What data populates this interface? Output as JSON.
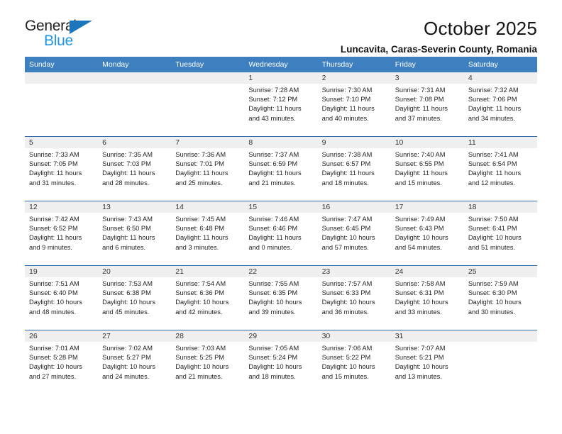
{
  "brand": {
    "name_part1": "General",
    "name_part2": "Blue",
    "accent_color": "#1b76bc",
    "logo_blue_text_color": "#2196e8"
  },
  "header": {
    "month_title": "October 2025",
    "location": "Luncavita, Caras-Severin County, Romania"
  },
  "calendar": {
    "header_background": "#3d7fbf",
    "row_rule_color": "#2e6da8",
    "daynum_band_color": "#efefef",
    "weekday_headers": [
      "Sunday",
      "Monday",
      "Tuesday",
      "Wednesday",
      "Thursday",
      "Friday",
      "Saturday"
    ],
    "weeks": [
      [
        {
          "day": "",
          "empty": true,
          "sunrise": "",
          "sunset": "",
          "daylight_line1": "",
          "daylight_line2": ""
        },
        {
          "day": "",
          "empty": true,
          "sunrise": "",
          "sunset": "",
          "daylight_line1": "",
          "daylight_line2": ""
        },
        {
          "day": "",
          "empty": true,
          "sunrise": "",
          "sunset": "",
          "daylight_line1": "",
          "daylight_line2": ""
        },
        {
          "day": "1",
          "empty": false,
          "sunrise": "Sunrise: 7:28 AM",
          "sunset": "Sunset: 7:12 PM",
          "daylight_line1": "Daylight: 11 hours",
          "daylight_line2": "and 43 minutes."
        },
        {
          "day": "2",
          "empty": false,
          "sunrise": "Sunrise: 7:30 AM",
          "sunset": "Sunset: 7:10 PM",
          "daylight_line1": "Daylight: 11 hours",
          "daylight_line2": "and 40 minutes."
        },
        {
          "day": "3",
          "empty": false,
          "sunrise": "Sunrise: 7:31 AM",
          "sunset": "Sunset: 7:08 PM",
          "daylight_line1": "Daylight: 11 hours",
          "daylight_line2": "and 37 minutes."
        },
        {
          "day": "4",
          "empty": false,
          "sunrise": "Sunrise: 7:32 AM",
          "sunset": "Sunset: 7:06 PM",
          "daylight_line1": "Daylight: 11 hours",
          "daylight_line2": "and 34 minutes."
        }
      ],
      [
        {
          "day": "5",
          "empty": false,
          "sunrise": "Sunrise: 7:33 AM",
          "sunset": "Sunset: 7:05 PM",
          "daylight_line1": "Daylight: 11 hours",
          "daylight_line2": "and 31 minutes."
        },
        {
          "day": "6",
          "empty": false,
          "sunrise": "Sunrise: 7:35 AM",
          "sunset": "Sunset: 7:03 PM",
          "daylight_line1": "Daylight: 11 hours",
          "daylight_line2": "and 28 minutes."
        },
        {
          "day": "7",
          "empty": false,
          "sunrise": "Sunrise: 7:36 AM",
          "sunset": "Sunset: 7:01 PM",
          "daylight_line1": "Daylight: 11 hours",
          "daylight_line2": "and 25 minutes."
        },
        {
          "day": "8",
          "empty": false,
          "sunrise": "Sunrise: 7:37 AM",
          "sunset": "Sunset: 6:59 PM",
          "daylight_line1": "Daylight: 11 hours",
          "daylight_line2": "and 21 minutes."
        },
        {
          "day": "9",
          "empty": false,
          "sunrise": "Sunrise: 7:38 AM",
          "sunset": "Sunset: 6:57 PM",
          "daylight_line1": "Daylight: 11 hours",
          "daylight_line2": "and 18 minutes."
        },
        {
          "day": "10",
          "empty": false,
          "sunrise": "Sunrise: 7:40 AM",
          "sunset": "Sunset: 6:55 PM",
          "daylight_line1": "Daylight: 11 hours",
          "daylight_line2": "and 15 minutes."
        },
        {
          "day": "11",
          "empty": false,
          "sunrise": "Sunrise: 7:41 AM",
          "sunset": "Sunset: 6:54 PM",
          "daylight_line1": "Daylight: 11 hours",
          "daylight_line2": "and 12 minutes."
        }
      ],
      [
        {
          "day": "12",
          "empty": false,
          "sunrise": "Sunrise: 7:42 AM",
          "sunset": "Sunset: 6:52 PM",
          "daylight_line1": "Daylight: 11 hours",
          "daylight_line2": "and 9 minutes."
        },
        {
          "day": "13",
          "empty": false,
          "sunrise": "Sunrise: 7:43 AM",
          "sunset": "Sunset: 6:50 PM",
          "daylight_line1": "Daylight: 11 hours",
          "daylight_line2": "and 6 minutes."
        },
        {
          "day": "14",
          "empty": false,
          "sunrise": "Sunrise: 7:45 AM",
          "sunset": "Sunset: 6:48 PM",
          "daylight_line1": "Daylight: 11 hours",
          "daylight_line2": "and 3 minutes."
        },
        {
          "day": "15",
          "empty": false,
          "sunrise": "Sunrise: 7:46 AM",
          "sunset": "Sunset: 6:46 PM",
          "daylight_line1": "Daylight: 11 hours",
          "daylight_line2": "and 0 minutes."
        },
        {
          "day": "16",
          "empty": false,
          "sunrise": "Sunrise: 7:47 AM",
          "sunset": "Sunset: 6:45 PM",
          "daylight_line1": "Daylight: 10 hours",
          "daylight_line2": "and 57 minutes."
        },
        {
          "day": "17",
          "empty": false,
          "sunrise": "Sunrise: 7:49 AM",
          "sunset": "Sunset: 6:43 PM",
          "daylight_line1": "Daylight: 10 hours",
          "daylight_line2": "and 54 minutes."
        },
        {
          "day": "18",
          "empty": false,
          "sunrise": "Sunrise: 7:50 AM",
          "sunset": "Sunset: 6:41 PM",
          "daylight_line1": "Daylight: 10 hours",
          "daylight_line2": "and 51 minutes."
        }
      ],
      [
        {
          "day": "19",
          "empty": false,
          "sunrise": "Sunrise: 7:51 AM",
          "sunset": "Sunset: 6:40 PM",
          "daylight_line1": "Daylight: 10 hours",
          "daylight_line2": "and 48 minutes."
        },
        {
          "day": "20",
          "empty": false,
          "sunrise": "Sunrise: 7:53 AM",
          "sunset": "Sunset: 6:38 PM",
          "daylight_line1": "Daylight: 10 hours",
          "daylight_line2": "and 45 minutes."
        },
        {
          "day": "21",
          "empty": false,
          "sunrise": "Sunrise: 7:54 AM",
          "sunset": "Sunset: 6:36 PM",
          "daylight_line1": "Daylight: 10 hours",
          "daylight_line2": "and 42 minutes."
        },
        {
          "day": "22",
          "empty": false,
          "sunrise": "Sunrise: 7:55 AM",
          "sunset": "Sunset: 6:35 PM",
          "daylight_line1": "Daylight: 10 hours",
          "daylight_line2": "and 39 minutes."
        },
        {
          "day": "23",
          "empty": false,
          "sunrise": "Sunrise: 7:57 AM",
          "sunset": "Sunset: 6:33 PM",
          "daylight_line1": "Daylight: 10 hours",
          "daylight_line2": "and 36 minutes."
        },
        {
          "day": "24",
          "empty": false,
          "sunrise": "Sunrise: 7:58 AM",
          "sunset": "Sunset: 6:31 PM",
          "daylight_line1": "Daylight: 10 hours",
          "daylight_line2": "and 33 minutes."
        },
        {
          "day": "25",
          "empty": false,
          "sunrise": "Sunrise: 7:59 AM",
          "sunset": "Sunset: 6:30 PM",
          "daylight_line1": "Daylight: 10 hours",
          "daylight_line2": "and 30 minutes."
        }
      ],
      [
        {
          "day": "26",
          "empty": false,
          "sunrise": "Sunrise: 7:01 AM",
          "sunset": "Sunset: 5:28 PM",
          "daylight_line1": "Daylight: 10 hours",
          "daylight_line2": "and 27 minutes."
        },
        {
          "day": "27",
          "empty": false,
          "sunrise": "Sunrise: 7:02 AM",
          "sunset": "Sunset: 5:27 PM",
          "daylight_line1": "Daylight: 10 hours",
          "daylight_line2": "and 24 minutes."
        },
        {
          "day": "28",
          "empty": false,
          "sunrise": "Sunrise: 7:03 AM",
          "sunset": "Sunset: 5:25 PM",
          "daylight_line1": "Daylight: 10 hours",
          "daylight_line2": "and 21 minutes."
        },
        {
          "day": "29",
          "empty": false,
          "sunrise": "Sunrise: 7:05 AM",
          "sunset": "Sunset: 5:24 PM",
          "daylight_line1": "Daylight: 10 hours",
          "daylight_line2": "and 18 minutes."
        },
        {
          "day": "30",
          "empty": false,
          "sunrise": "Sunrise: 7:06 AM",
          "sunset": "Sunset: 5:22 PM",
          "daylight_line1": "Daylight: 10 hours",
          "daylight_line2": "and 15 minutes."
        },
        {
          "day": "31",
          "empty": false,
          "sunrise": "Sunrise: 7:07 AM",
          "sunset": "Sunset: 5:21 PM",
          "daylight_line1": "Daylight: 10 hours",
          "daylight_line2": "and 13 minutes."
        },
        {
          "day": "",
          "empty": true,
          "sunrise": "",
          "sunset": "",
          "daylight_line1": "",
          "daylight_line2": ""
        }
      ]
    ]
  }
}
